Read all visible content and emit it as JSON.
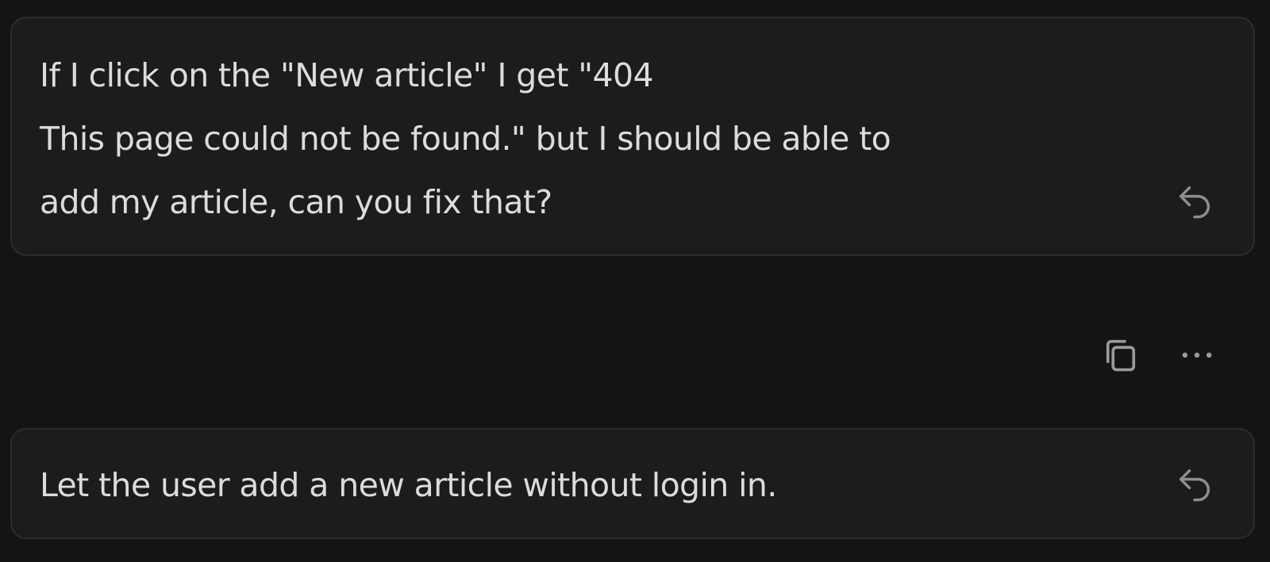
{
  "conversation": {
    "messages": [
      {
        "text": "If I click on the \"New article\" I get \"404\nThis page could not be found.\" but I should be able to\nadd my article, can you fix that?",
        "action_icon": "reply-icon"
      },
      {
        "text": "Let the user add a new article without login in.",
        "action_icon": "reply-icon"
      }
    ],
    "toolbar": {
      "icons": [
        "copy-icon",
        "more-options-icon"
      ]
    }
  },
  "colors": {
    "background": "#141414",
    "card_background": "#1c1c1c",
    "card_border": "#2c2c2c",
    "text": "#dcdcdc",
    "icon": "#8e8e8e"
  }
}
